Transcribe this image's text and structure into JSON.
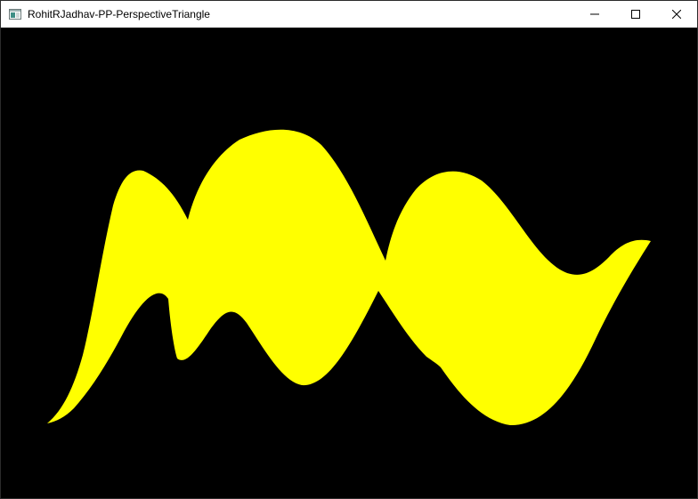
{
  "window": {
    "title": "RohitRJadhav-PP-PerspectiveTriangle",
    "icon": "app-window-icon",
    "buttons": [
      {
        "name": "minimize-button",
        "icon": "minimize-icon"
      },
      {
        "name": "maximize-button",
        "icon": "maximize-icon"
      },
      {
        "name": "close-button",
        "icon": "close-icon"
      }
    ]
  },
  "canvas": {
    "background_color": "#000000",
    "shape_color": "#ffff00",
    "shape": "yellow wavy surface"
  }
}
